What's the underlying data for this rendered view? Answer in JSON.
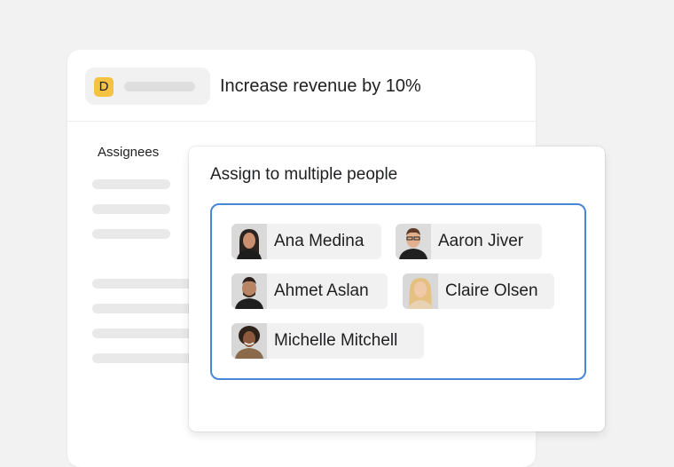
{
  "goal": {
    "badge_letter": "D",
    "title": "Increase revenue by 10%"
  },
  "sidebar": {
    "assignees_label": "Assignees"
  },
  "popup": {
    "title": "Assign to multiple people",
    "people": [
      {
        "name": "Ana Medina"
      },
      {
        "name": "Aaron Jiver"
      },
      {
        "name": "Ahmet Aslan"
      },
      {
        "name": "Claire Olsen"
      },
      {
        "name": "Michelle Mitchell"
      }
    ]
  },
  "colors": {
    "accent": "#4a86d6",
    "badge": "#f5c242",
    "background": "#f2f2f2"
  }
}
